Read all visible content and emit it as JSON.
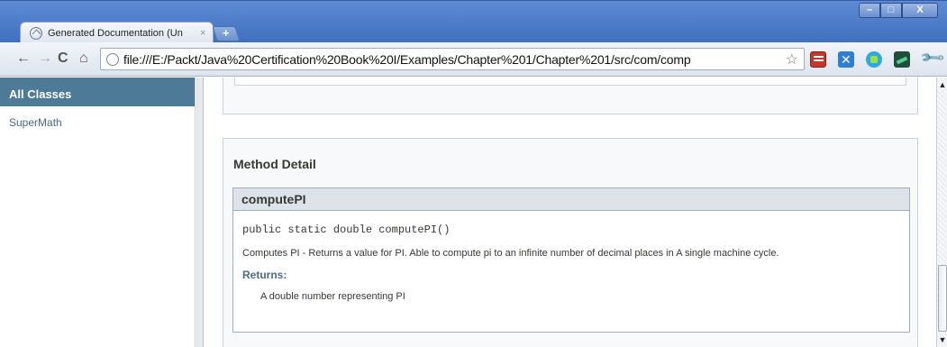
{
  "window": {
    "min_glyph": "–",
    "max_glyph": "□",
    "close_glyph": "X"
  },
  "tab": {
    "title": "Generated Documentation (Un",
    "close_glyph": "×",
    "icon": "page-globe-icon"
  },
  "new_tab_glyph": "+",
  "toolbar": {
    "back_glyph": "←",
    "forward_glyph": "→",
    "reload_glyph": "C",
    "home_glyph": "⌂",
    "url": "file:///E:/Packt/Java%20Certification%20Book%20I/Examples/Chapter%201/Chapter%201/src/com/comp",
    "star_glyph": "☆",
    "wrench_glyph": "🔧"
  },
  "sidebar": {
    "header": "All Classes",
    "links": [
      "SuperMath"
    ]
  },
  "doc": {
    "section_title": "Method Detail",
    "method": {
      "name": "computePI",
      "signature": "public static double computePI()",
      "description": "Computes PI - Returns a value for PI. Able to compute pi to an infinite number of decimal places in A single machine cycle.",
      "returns_label": "Returns:",
      "returns_text": "A double number representing PI"
    }
  },
  "scrollbar": {
    "up_glyph": "▲",
    "down_glyph": "▼"
  },
  "colors": {
    "tabstrip": "#4a7bc8",
    "sidebar_header": "#4d7a97",
    "method_header": "#dee3e9"
  }
}
